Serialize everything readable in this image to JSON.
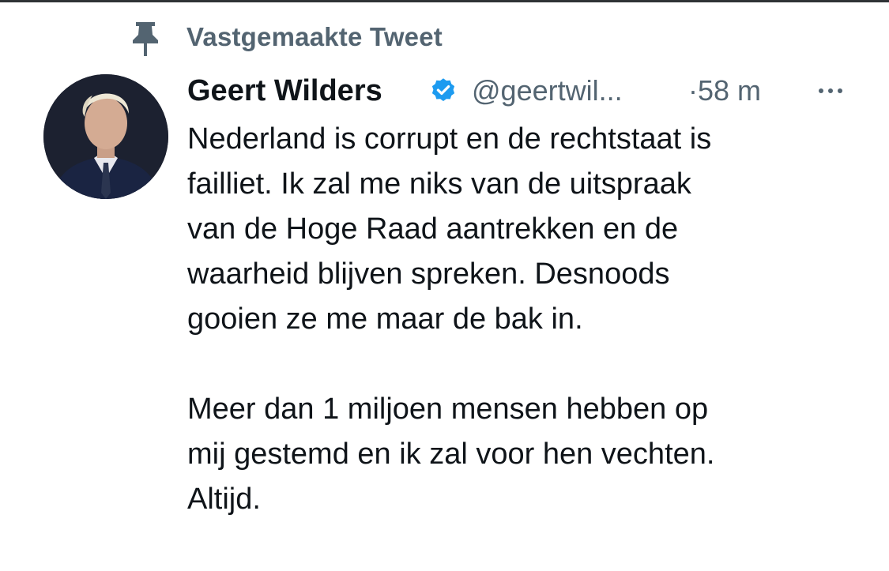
{
  "pinned": {
    "label": "Vastgemaakte Tweet",
    "icon": "pin-icon"
  },
  "tweet": {
    "author": {
      "display_name": "Geert Wilders",
      "handle": "@geertwil...",
      "verified": true,
      "verified_icon": "verified-badge-icon",
      "avatar_icon": "avatar"
    },
    "time": "·58 m",
    "more_icon": "more-options-icon",
    "text_lines_1": [
      "Nederland is corrupt en de rechtstaat is",
      "failliet. Ik zal me niks van de uitspraak",
      "van de Hoge Raad aantrekken en de",
      "waarheid blijven spreken. Desnoods",
      "gooien ze me maar de bak in."
    ],
    "text_lines_2": [
      "Meer dan 1 miljoen mensen hebben op",
      "mij gestemd en ik zal voor hen vechten.",
      "Altijd."
    ]
  },
  "colors": {
    "accent": "#1d9bf0",
    "secondary_text": "#536471",
    "primary_text": "#0f1419"
  }
}
